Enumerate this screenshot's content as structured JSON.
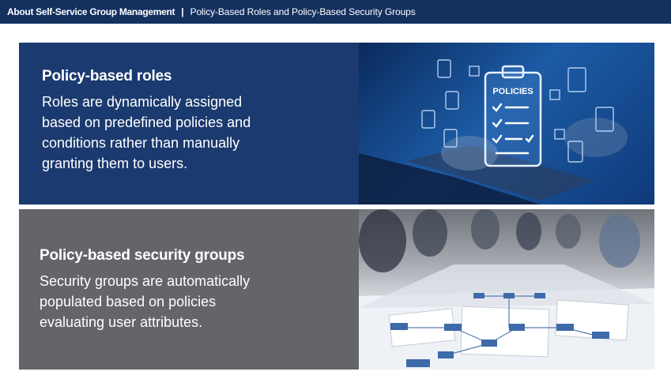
{
  "header": {
    "section": "About Self-Service Group Management",
    "separator": "|",
    "subtitle": "Policy-Based Roles and Policy-Based Security Groups"
  },
  "cards": [
    {
      "title": "Policy-based roles",
      "body": "Roles are dynamically assigned based on predefined policies and conditions rather than manually granting them to users.",
      "image": {
        "icon": "policies-clipboard-icon",
        "label": "POLICIES"
      }
    },
    {
      "title": "Policy-based security groups",
      "body": "Security groups are automatically populated based on policies evaluating user attributes.",
      "image": {
        "icon": "meeting-table-diagram-photo"
      }
    }
  ],
  "colors": {
    "header_bg": "#13305f",
    "card_top_bg": "#1b3a6f",
    "card_bottom_bg": "#636569"
  }
}
